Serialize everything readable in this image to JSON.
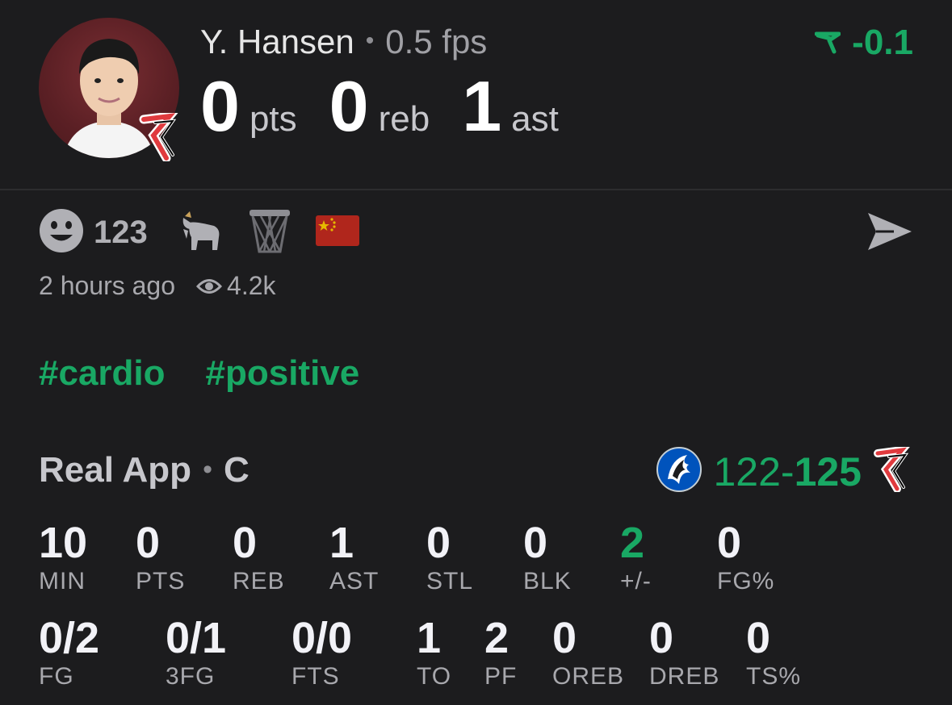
{
  "player": {
    "name": "Y. Hansen",
    "fps": "0.5 fps",
    "rating": "-0.1"
  },
  "big_stats": [
    {
      "value": "0",
      "unit": "pts"
    },
    {
      "value": "0",
      "unit": "reb"
    },
    {
      "value": "1",
      "unit": "ast"
    }
  ],
  "reactions": {
    "smile_count": "123",
    "icons": [
      "smile-icon",
      "goat-icon",
      "basketball-net-icon",
      "china-flag-icon"
    ]
  },
  "meta": {
    "time": "2 hours ago",
    "views": "4.2k"
  },
  "tags": [
    "#cardio",
    "#positive"
  ],
  "source": {
    "app": "Real App",
    "position": "C"
  },
  "score": {
    "away": "122",
    "separator": "-",
    "home": "125"
  },
  "stats_row1": [
    {
      "value": "10",
      "label": "MIN"
    },
    {
      "value": "0",
      "label": "PTS"
    },
    {
      "value": "0",
      "label": "REB"
    },
    {
      "value": "1",
      "label": "AST"
    },
    {
      "value": "0",
      "label": "STL"
    },
    {
      "value": "0",
      "label": "BLK"
    },
    {
      "value": "2",
      "label": "+/-"
    },
    {
      "value": "0",
      "label": "FG%"
    }
  ],
  "stats_row2": [
    {
      "value": "0/2",
      "label": "FG"
    },
    {
      "value": "0/1",
      "label": "3FG"
    },
    {
      "value": "0/0",
      "label": "FTS"
    },
    {
      "value": "1",
      "label": "TO"
    },
    {
      "value": "2",
      "label": "PF"
    },
    {
      "value": "0",
      "label": "OREB"
    },
    {
      "value": "0",
      "label": "DREB"
    },
    {
      "value": "0",
      "label": "TS%"
    }
  ],
  "colors": {
    "accent_green": "#19a864",
    "background": "#1c1c1e",
    "blazers_red": "#e03a3e",
    "mavs_blue": "#0053bc"
  }
}
